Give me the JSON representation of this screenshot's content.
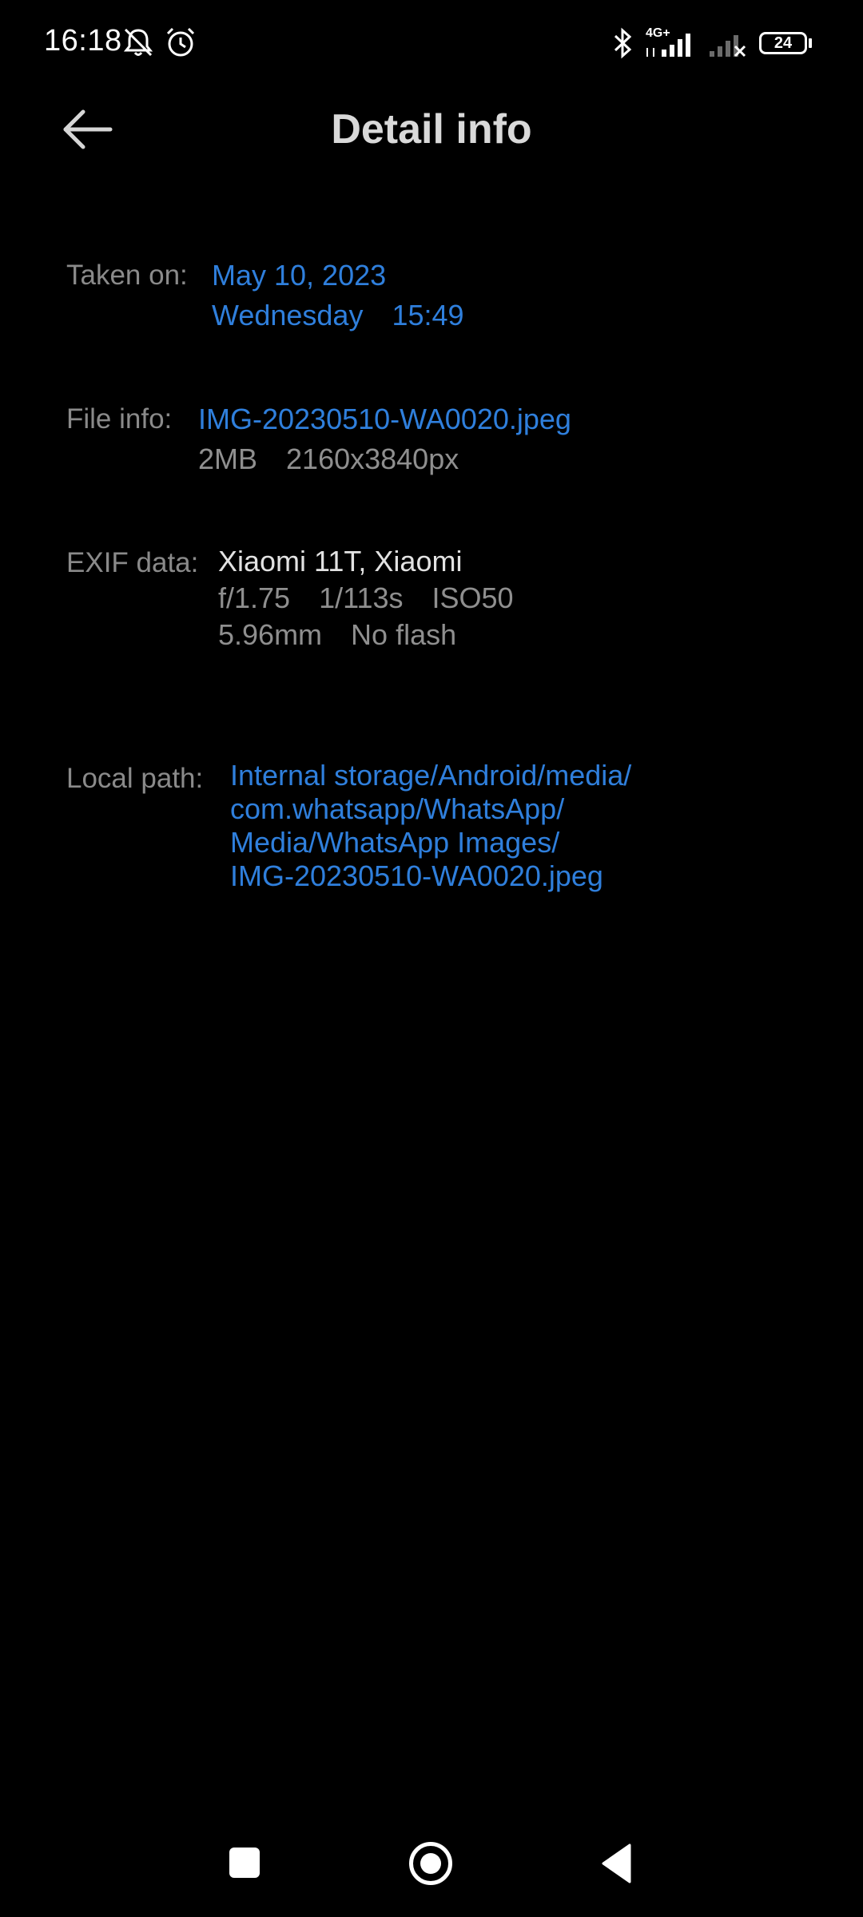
{
  "status_bar": {
    "time": "16:18",
    "network_label": "4G+",
    "battery": "24",
    "icons": [
      "bell-off-icon",
      "alarm-icon",
      "bluetooth-icon",
      "signal-icon",
      "no-signal-icon",
      "battery-icon"
    ]
  },
  "header": {
    "title": "Detail info",
    "back_icon": "arrow-left-icon"
  },
  "details": {
    "taken_on": {
      "label": "Taken on:",
      "date": "May 10, 2023",
      "weekday": "Wednesday",
      "time": "15:49"
    },
    "file_info": {
      "label": "File info:",
      "filename": "IMG-20230510-WA0020.jpeg",
      "size": "2MB",
      "resolution": "2160x3840px"
    },
    "exif": {
      "label": "EXIF data:",
      "device": "Xiaomi 11T, Xiaomi",
      "aperture": "f/1.75",
      "shutter": "1/113s",
      "iso": "ISO50",
      "focal_length": "5.96mm",
      "flash": "No flash"
    },
    "local_path": {
      "label": "Local path:",
      "lines": [
        "Internal storage/Android/media/",
        "com.whatsapp/WhatsApp/",
        "Media/WhatsApp Images/",
        "IMG-20230510-WA0020.jpeg"
      ]
    }
  },
  "nav_bar": {
    "icons": [
      "recents-square-icon",
      "home-circle-icon",
      "back-triangle-icon"
    ]
  },
  "colors": {
    "background": "#000000",
    "link_blue": "#2f7fdc",
    "label_grey": "#8a8a8a",
    "title": "#d9d9d9"
  }
}
